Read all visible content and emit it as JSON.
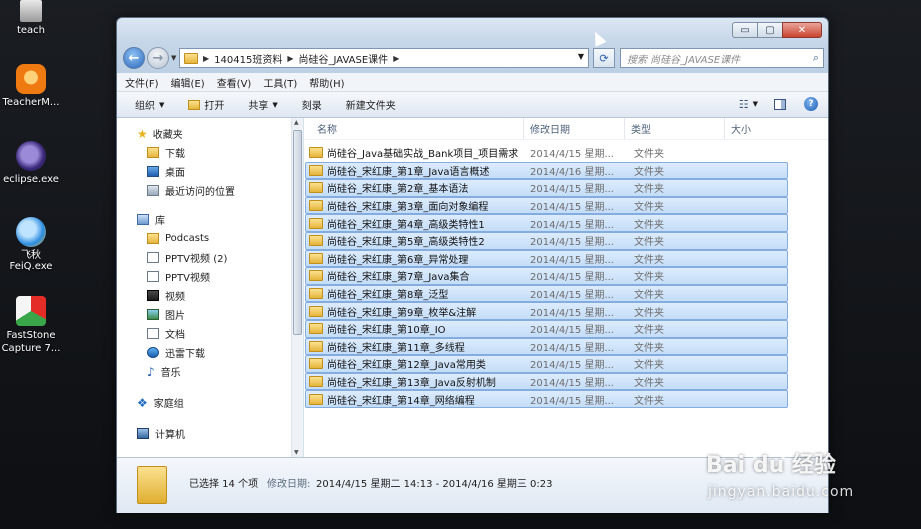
{
  "desktop": {
    "icons": [
      {
        "label": "teach"
      },
      {
        "label": "TeacherM..."
      },
      {
        "label": "eclipse.exe"
      },
      {
        "label": "飞秋\nFeiQ.exe"
      },
      {
        "label": "FastStone\nCapture 7..."
      }
    ],
    "watermark": {
      "brand": "Bai  du 经验",
      "url": "jingyan.baidu.com"
    }
  },
  "window": {
    "controls": {
      "minimize": "▭",
      "maximize": "▢",
      "close": "✕"
    },
    "breadcrumb": [
      "140415班资料",
      "尚硅谷_JAVASE课件"
    ],
    "search_placeholder": "搜索 尚硅谷_JAVASE课件",
    "menu": [
      "文件(F)",
      "编辑(E)",
      "查看(V)",
      "工具(T)",
      "帮助(H)"
    ],
    "toolbar": {
      "organize": "组织",
      "open": "打开",
      "share": "共享",
      "burn": "刻录",
      "new_folder": "新建文件夹"
    },
    "nav_pane": {
      "favorites": {
        "label": "收藏夹",
        "items": [
          "下载",
          "桌面",
          "最近访问的位置"
        ]
      },
      "libraries": {
        "label": "库",
        "items": [
          "Podcasts",
          "PPTV视频 (2)",
          "PPTV视频",
          "视频",
          "图片",
          "文档",
          "迅雷下载",
          "音乐"
        ]
      },
      "homegroup": "家庭组",
      "computer": "计算机"
    },
    "columns": {
      "name": "名称",
      "date": "修改日期",
      "type": "类型",
      "size": "大小"
    },
    "files": [
      {
        "name": "尚硅谷_Java基础实战_Bank项目_项目需求",
        "date": "2014/4/15 星期...",
        "type": "文件夹",
        "selected": false
      },
      {
        "name": "尚硅谷_宋红康_第1章_Java语言概述",
        "date": "2014/4/16 星期...",
        "type": "文件夹",
        "selected": true
      },
      {
        "name": "尚硅谷_宋红康_第2章_基本语法",
        "date": "2014/4/15 星期...",
        "type": "文件夹",
        "selected": true
      },
      {
        "name": "尚硅谷_宋红康_第3章_面向对象编程",
        "date": "2014/4/15 星期...",
        "type": "文件夹",
        "selected": true
      },
      {
        "name": "尚硅谷_宋红康_第4章_高级类特性1",
        "date": "2014/4/15 星期...",
        "type": "文件夹",
        "selected": true
      },
      {
        "name": "尚硅谷_宋红康_第5章_高级类特性2",
        "date": "2014/4/15 星期...",
        "type": "文件夹",
        "selected": true
      },
      {
        "name": "尚硅谷_宋红康_第6章_异常处理",
        "date": "2014/4/15 星期...",
        "type": "文件夹",
        "selected": true
      },
      {
        "name": "尚硅谷_宋红康_第7章_Java集合",
        "date": "2014/4/15 星期...",
        "type": "文件夹",
        "selected": true
      },
      {
        "name": "尚硅谷_宋红康_第8章_泛型",
        "date": "2014/4/15 星期...",
        "type": "文件夹",
        "selected": true
      },
      {
        "name": "尚硅谷_宋红康_第9章_枚举&注解",
        "date": "2014/4/15 星期...",
        "type": "文件夹",
        "selected": true
      },
      {
        "name": "尚硅谷_宋红康_第10章_IO",
        "date": "2014/4/15 星期...",
        "type": "文件夹",
        "selected": true
      },
      {
        "name": "尚硅谷_宋红康_第11章_多线程",
        "date": "2014/4/15 星期...",
        "type": "文件夹",
        "selected": true
      },
      {
        "name": "尚硅谷_宋红康_第12章_Java常用类",
        "date": "2014/4/15 星期...",
        "type": "文件夹",
        "selected": true
      },
      {
        "name": "尚硅谷_宋红康_第13章_Java反射机制",
        "date": "2014/4/15 星期...",
        "type": "文件夹",
        "selected": true
      },
      {
        "name": "尚硅谷_宋红康_第14章_网络编程",
        "date": "2014/4/15 星期...",
        "type": "文件夹",
        "selected": true
      }
    ],
    "details": {
      "selected_count": "已选择 14 个项",
      "modified_label": "修改日期:",
      "modified_value": "2014/4/15 星期二 14:13 - 2014/4/16 星期三 0:23"
    }
  },
  "colors": {
    "selection": "#c4ddf8",
    "selection_border": "#84acdd",
    "accent": "#1f5fad"
  }
}
